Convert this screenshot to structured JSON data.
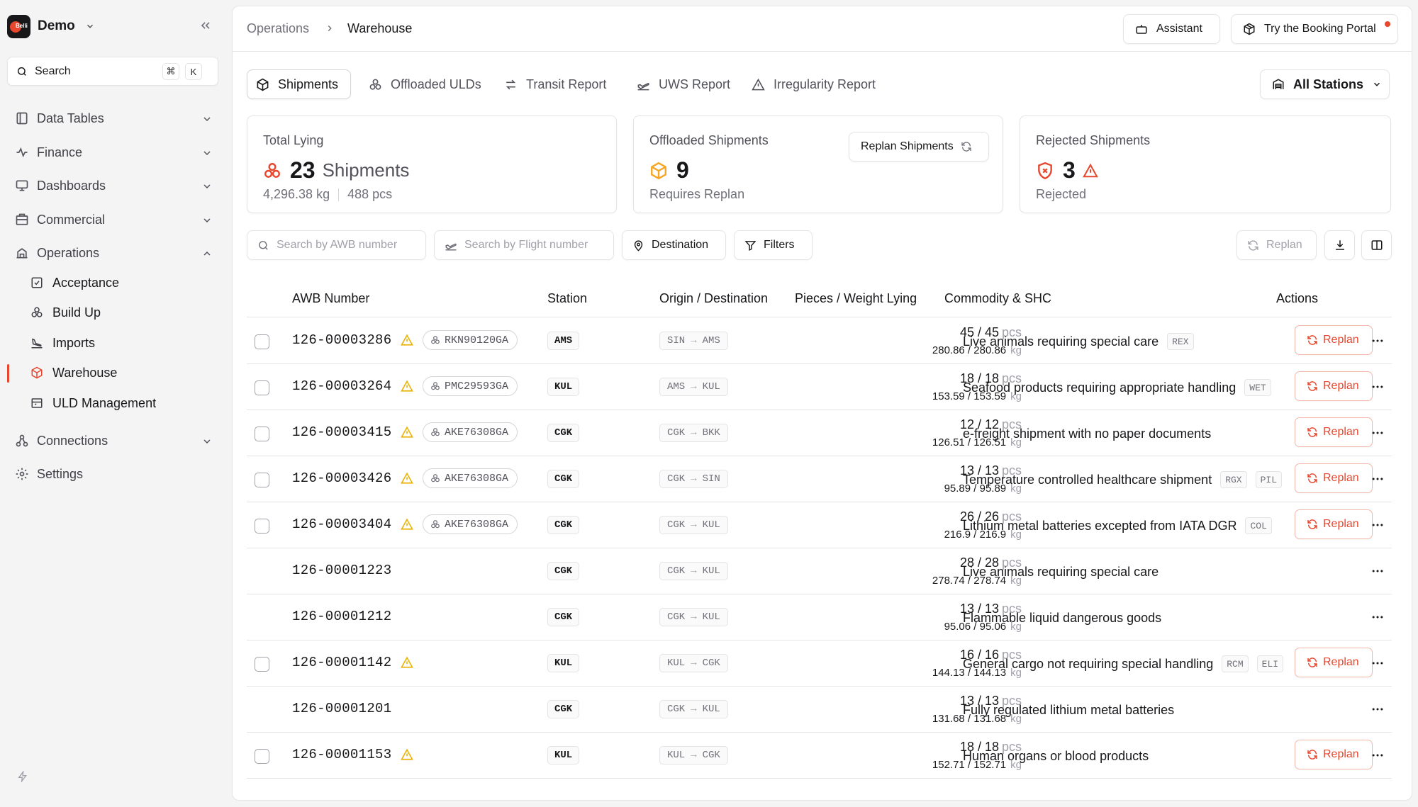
{
  "workspace": {
    "name": "Demo",
    "logo_text": "Belli"
  },
  "sidebar": {
    "search": {
      "label": "Search",
      "kbd1": "⌘",
      "kbd2": "K"
    },
    "items": [
      {
        "label": "Data Tables",
        "icon": "table-icon"
      },
      {
        "label": "Finance",
        "icon": "finance-icon"
      },
      {
        "label": "Dashboards",
        "icon": "monitor-icon"
      },
      {
        "label": "Commercial",
        "icon": "building-icon"
      },
      {
        "label": "Operations",
        "icon": "operations-icon",
        "expanded": true
      },
      {
        "label": "Connections",
        "icon": "connections-icon"
      },
      {
        "label": "Settings",
        "icon": "gear-icon"
      }
    ],
    "sub_items": [
      {
        "label": "Acceptance",
        "icon": "check-square-icon"
      },
      {
        "label": "Build Up",
        "icon": "boxes-icon"
      },
      {
        "label": "Imports",
        "icon": "plane-landing-icon"
      },
      {
        "label": "Warehouse",
        "icon": "warehouse-icon",
        "active": true
      },
      {
        "label": "ULD Management",
        "icon": "container-icon"
      }
    ]
  },
  "header": {
    "breadcrumb": [
      "Operations",
      "Warehouse"
    ],
    "assistant_label": "Assistant",
    "portal_label": "Try the Booking Portal"
  },
  "tabs": [
    {
      "label": "Shipments",
      "active": true
    },
    {
      "label": "Offloaded ULDs"
    },
    {
      "label": "Transit Report"
    },
    {
      "label": "UWS Report"
    },
    {
      "label": "Irregularity Report"
    }
  ],
  "stations_select": "All Stations",
  "cards": {
    "total": {
      "title": "Total Lying",
      "value": "23",
      "unit": "Shipments",
      "weight": "4,296.38 kg",
      "pieces": "488 pcs"
    },
    "offloaded": {
      "title": "Offloaded Shipments",
      "value": "9",
      "sub": "Requires Replan",
      "button": "Replan Shipments"
    },
    "rejected": {
      "title": "Rejected Shipments",
      "value": "3",
      "sub": "Rejected"
    }
  },
  "filters": {
    "awb_placeholder": "Search by AWB number",
    "flight_placeholder": "Search by Flight number",
    "destination": "Destination",
    "filters": "Filters",
    "replan": "Replan"
  },
  "table": {
    "columns": [
      "AWB Number",
      "Station",
      "Origin / Destination",
      "Pieces / Weight Lying",
      "Commodity & SHC",
      "Actions"
    ],
    "rows": [
      {
        "awb": "126-00003286",
        "warn": true,
        "uld": "RKN90120GA",
        "station": "AMS",
        "origin": "SIN",
        "dest": "AMS",
        "pcs": "45 / 45",
        "wt": "280.86 / 280.86",
        "commodity": "Live animals requiring special care",
        "shc": [
          "REX"
        ],
        "replan": true
      },
      {
        "awb": "126-00003264",
        "warn": true,
        "uld": "PMC29593GA",
        "station": "KUL",
        "origin": "AMS",
        "dest": "KUL",
        "pcs": "18 / 18",
        "wt": "153.59 / 153.59",
        "commodity": "Seafood products requiring appropriate handling",
        "shc": [
          "WET"
        ],
        "replan": true
      },
      {
        "awb": "126-00003415",
        "warn": true,
        "uld": "AKE76308GA",
        "station": "CGK",
        "origin": "CGK",
        "dest": "BKK",
        "pcs": "12 / 12",
        "wt": "126.51 / 126.51",
        "commodity": "e-freight shipment with no paper documents",
        "shc": [],
        "replan": true
      },
      {
        "awb": "126-00003426",
        "warn": true,
        "uld": "AKE76308GA",
        "station": "CGK",
        "origin": "CGK",
        "dest": "SIN",
        "pcs": "13 / 13",
        "wt": "95.89 / 95.89",
        "commodity": "Temperature controlled healthcare shipment",
        "shc": [
          "RGX",
          "PIL"
        ],
        "replan": true
      },
      {
        "awb": "126-00003404",
        "warn": true,
        "uld": "AKE76308GA",
        "station": "CGK",
        "origin": "CGK",
        "dest": "KUL",
        "pcs": "26 / 26",
        "wt": "216.9 / 216.9",
        "commodity": "Lithium metal batteries excepted from IATA DGR",
        "shc": [
          "COL"
        ],
        "replan": true
      },
      {
        "awb": "126-00001223",
        "warn": false,
        "uld": "",
        "station": "CGK",
        "origin": "CGK",
        "dest": "KUL",
        "pcs": "28 / 28",
        "wt": "278.74 / 278.74",
        "commodity": "Live animals requiring special care",
        "shc": [],
        "replan": false
      },
      {
        "awb": "126-00001212",
        "warn": false,
        "uld": "",
        "station": "CGK",
        "origin": "CGK",
        "dest": "KUL",
        "pcs": "13 / 13",
        "wt": "95.06 / 95.06",
        "commodity": "Flammable liquid dangerous goods",
        "shc": [],
        "replan": false
      },
      {
        "awb": "126-00001142",
        "warn": true,
        "uld": "",
        "station": "KUL",
        "origin": "KUL",
        "dest": "CGK",
        "pcs": "16 / 16",
        "wt": "144.13 / 144.13",
        "commodity": "General cargo not requiring special handling",
        "shc": [
          "RCM",
          "ELI"
        ],
        "replan": true
      },
      {
        "awb": "126-00001201",
        "warn": false,
        "uld": "",
        "station": "CGK",
        "origin": "CGK",
        "dest": "KUL",
        "pcs": "13 / 13",
        "wt": "131.68 / 131.68",
        "commodity": "Fully regulated lithium metal batteries",
        "shc": [],
        "replan": false
      },
      {
        "awb": "126-00001153",
        "warn": true,
        "uld": "",
        "station": "KUL",
        "origin": "KUL",
        "dest": "CGK",
        "pcs": "18 / 18",
        "wt": "152.71 / 152.71",
        "commodity": "Human organs or blood products",
        "shc": [],
        "replan": true
      }
    ],
    "pcs_unit": "pcs",
    "kg_unit": "kg",
    "replan_label": "Replan"
  },
  "colors": {
    "accent": "#e8462d",
    "warning": "#eab308",
    "offload": "#f5a623"
  }
}
